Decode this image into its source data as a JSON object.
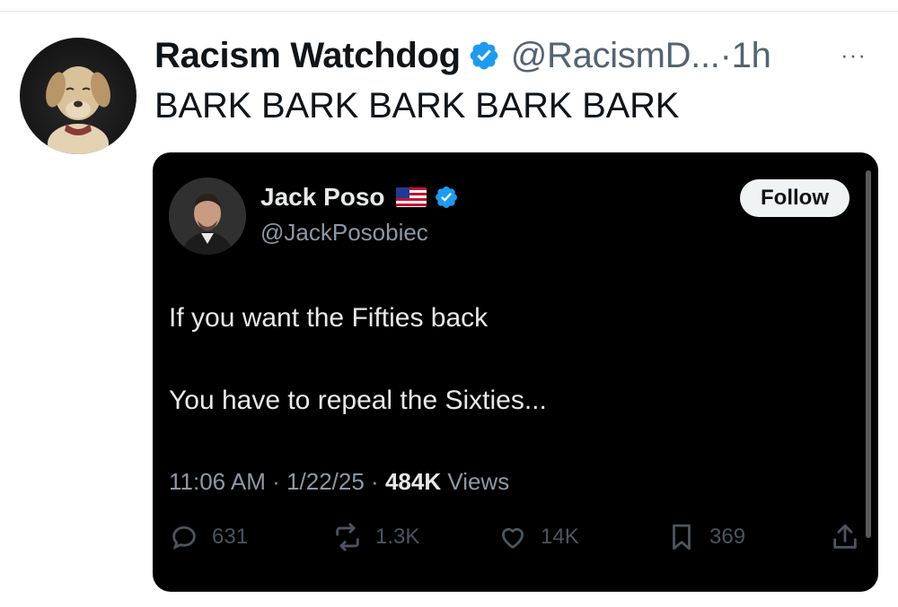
{
  "tweet": {
    "author_name": "Racism Watchdog",
    "author_handle": "@RacismD...",
    "time": "1h",
    "text": "BARK BARK BARK BARK BARK",
    "more_label": "···"
  },
  "quoted": {
    "author_name": "Jack Poso",
    "author_handle": "@JackPosobiec",
    "follow_label": "Follow",
    "line1": "If you want the Fifties back",
    "line2": "You have to repeal the Sixties...",
    "time": "11:06 AM",
    "date": "1/22/25",
    "views_count": "484K",
    "views_label": "Views",
    "replies": "631",
    "reposts": "1.3K",
    "likes": "14K",
    "bookmarks": "369"
  },
  "colors": {
    "verified": "#1d9bf0",
    "text_primary": "#0f1419",
    "text_secondary": "#536471",
    "card_bg": "#000000"
  }
}
